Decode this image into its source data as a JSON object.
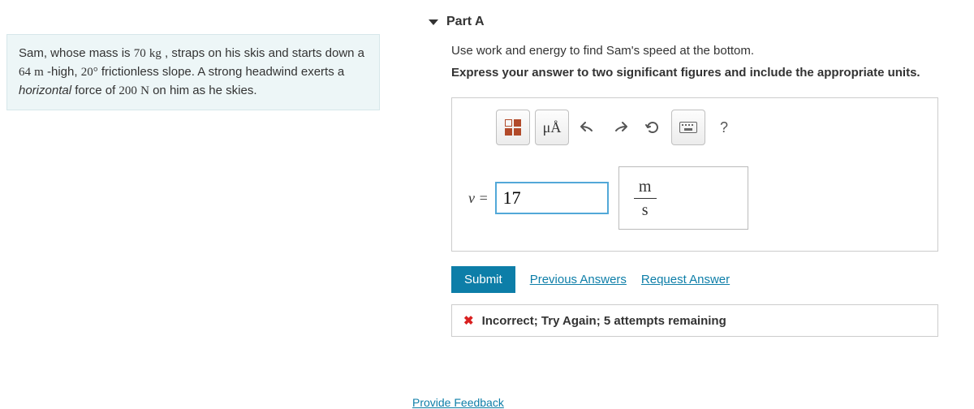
{
  "problem": {
    "pre1": "Sam, whose mass is ",
    "m_val": "70",
    "m_unit": "kg",
    "sp1": " , straps on his skis and starts down a ",
    "h_val": "64",
    "h_unit": "m",
    "sp2": " -high, ",
    "ang": "20°",
    "sp3": " frictionless slope. A strong headwind exerts a ",
    "ital": "horizontal",
    "sp4": " force of ",
    "f_val": "200",
    "f_unit": "N",
    "sp5": " on him as he skies."
  },
  "part": {
    "label": "Part A",
    "instruction": "Use work and energy to find Sam's speed at the bottom.",
    "format": "Express your answer to two significant figures and include the appropriate units."
  },
  "toolbar": {
    "units_symbol": "μÅ",
    "help_symbol": "?"
  },
  "answer": {
    "var_label": "v =",
    "value": "17",
    "unit_num": "m",
    "unit_den": "s"
  },
  "actions": {
    "submit": "Submit",
    "previous": "Previous Answers",
    "request": "Request Answer"
  },
  "feedback": {
    "icon": "✖",
    "text": "Incorrect; Try Again; 5 attempts remaining"
  },
  "footer": {
    "provide": "Provide Feedback"
  }
}
